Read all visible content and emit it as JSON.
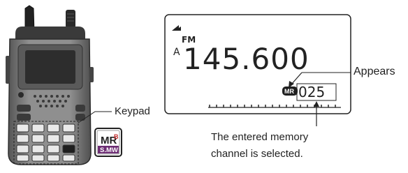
{
  "radio": {
    "display_lines": [
      "MR",
      "B",
      "S.MW"
    ]
  },
  "lcd": {
    "mode": "FM",
    "band": "A",
    "frequency": "145.600",
    "mr_badge": "MR",
    "channel": "025"
  },
  "callouts": {
    "keypad": "Keypad",
    "appears": "Appears",
    "note_line1": "The entered memory",
    "note_line2": "channel is selected."
  },
  "colors": {
    "key_red": "#c42c2c",
    "key_purple": "#6c2d73",
    "body_gray": "#8a8a8a",
    "dark": "#1f1f1f"
  }
}
